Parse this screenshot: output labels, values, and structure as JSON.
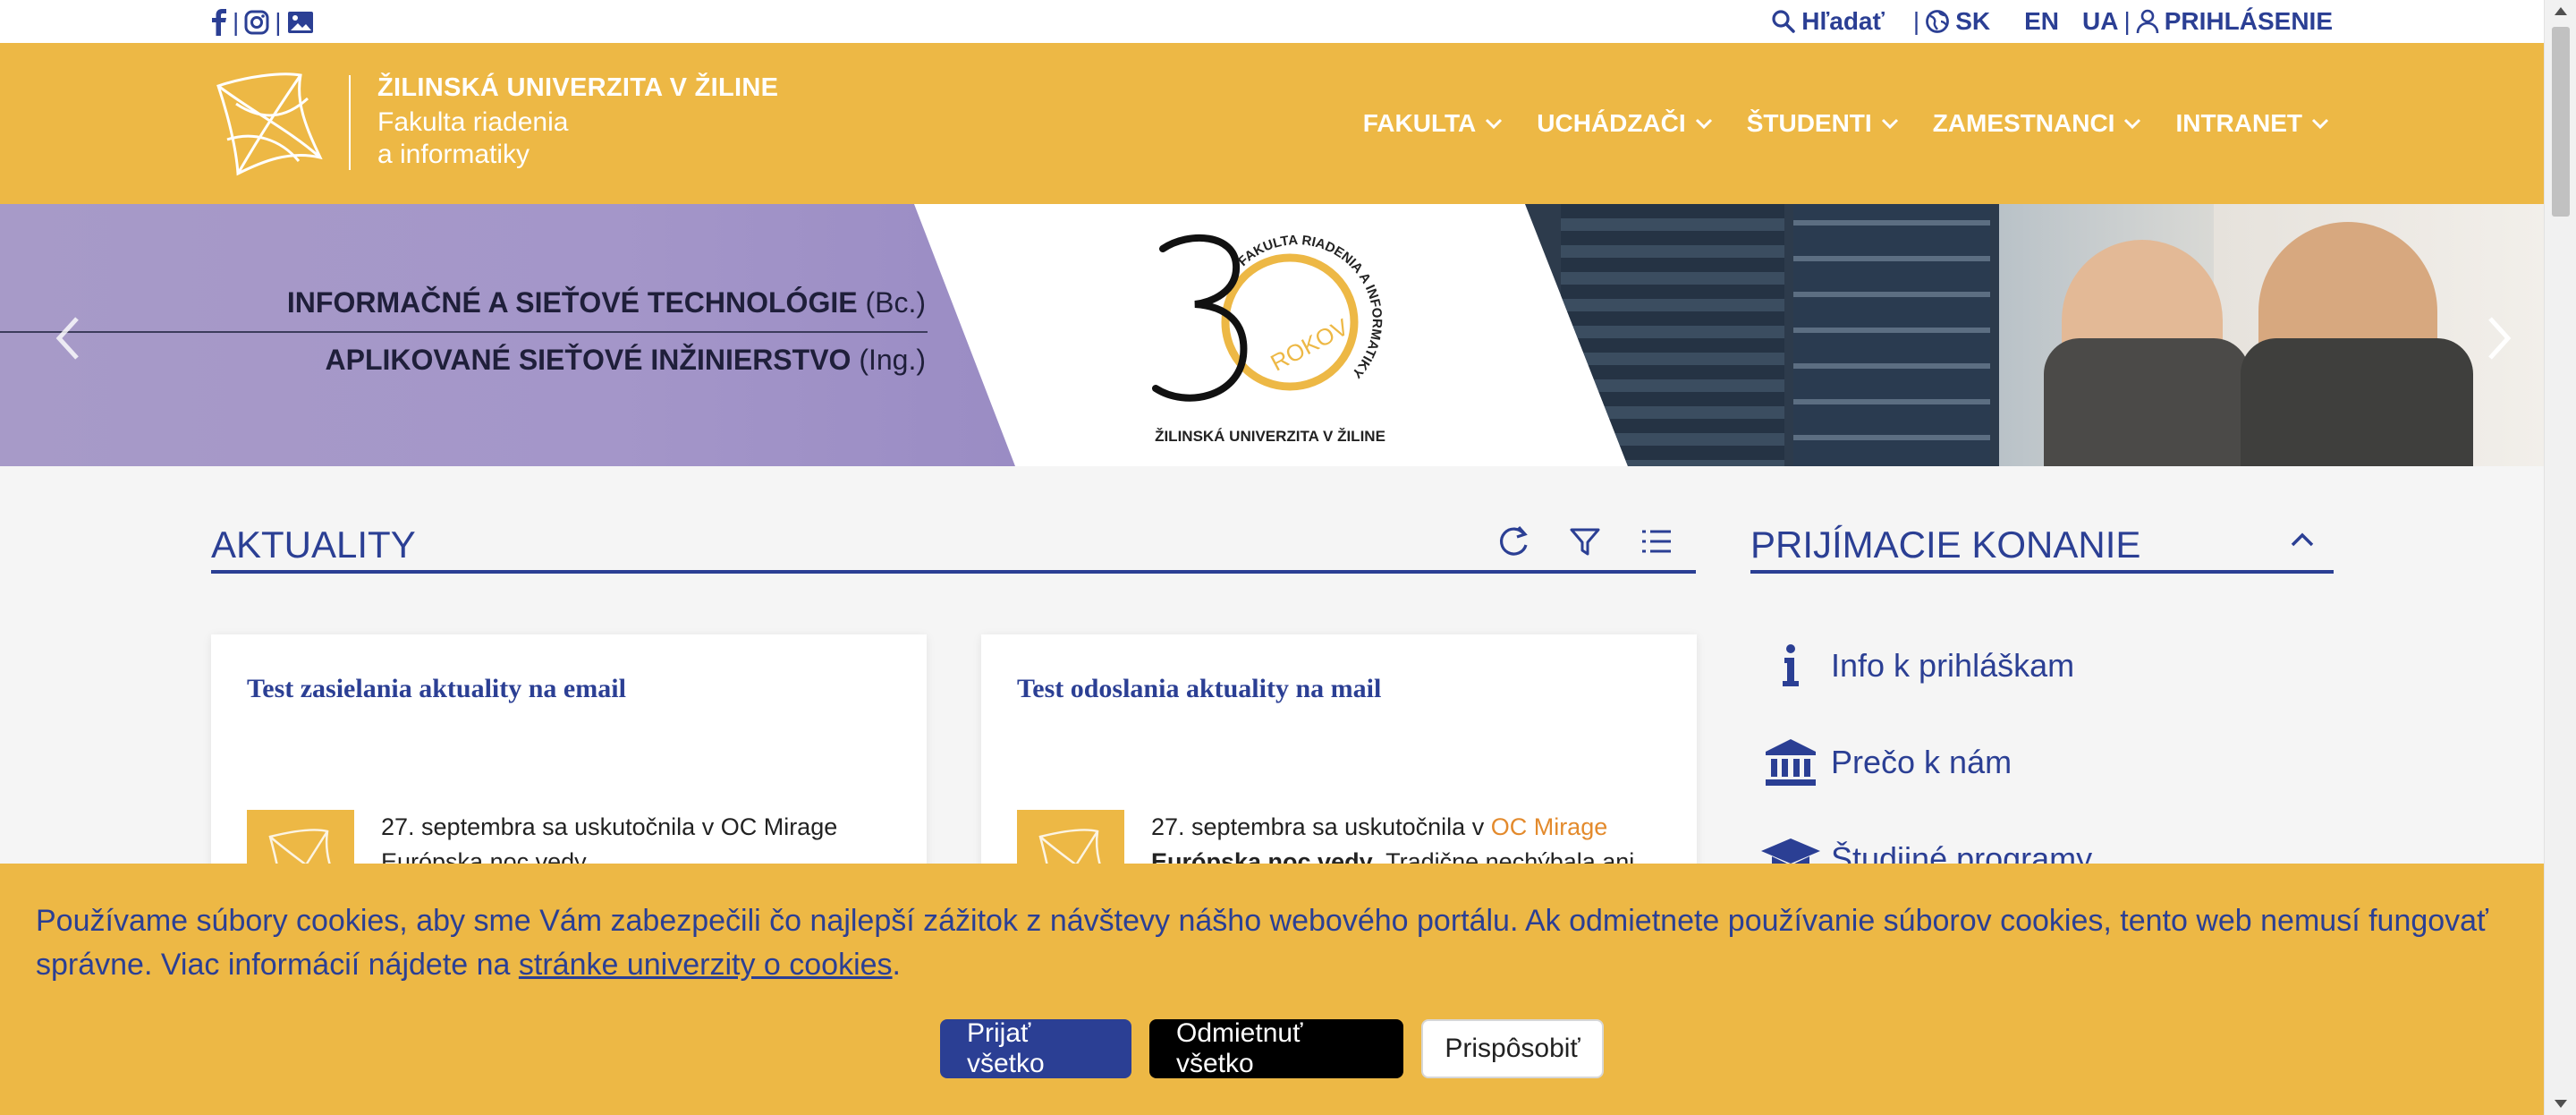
{
  "colors": {
    "accent_yellow": "#edb845",
    "brand_blue": "#2b3f94",
    "link_orange": "#e38a2c"
  },
  "topbar": {
    "social_icons": [
      "facebook-icon",
      "instagram-icon",
      "gallery-icon"
    ],
    "separator": "|",
    "search_label": "Hľadať",
    "lang_sk": "SK",
    "lang_en": "EN",
    "lang_ua": "UA",
    "login_label": "PRIHLÁSENIE"
  },
  "header": {
    "university": "ŽILINSKÁ UNIVERZITA V ŽILINE",
    "faculty_line1": "Fakulta riadenia",
    "faculty_line2": "a informatiky",
    "nav": [
      {
        "label": "FAKULTA"
      },
      {
        "label": "UCHÁDZAČI"
      },
      {
        "label": "ŠTUDENTI"
      },
      {
        "label": "ZAMESTNANCI"
      },
      {
        "label": "INTRANET"
      }
    ]
  },
  "hero": {
    "program1": "INFORMAČNÉ A SIEŤOVÉ TECHNOLÓGIE",
    "program1_degree": "(Bc.)",
    "program2": "APLIKOVANÉ SIEŤOVÉ INŽINIERSTVO",
    "program2_degree": "(Ing.)",
    "badge_number": "30",
    "badge_ring_text": "FAKULTA RIADENIA A INFORMATIKY",
    "badge_years": "ROKOV",
    "badge_caption": "ŽILINSKÁ UNIVERZITA V ŽILINE"
  },
  "news": {
    "title": "AKTUALITY",
    "tools": [
      "refresh-icon",
      "filter-icon",
      "list-icon"
    ],
    "cards": [
      {
        "title": "Test zasielania aktuality na email",
        "excerpt_lead": "27. septembra sa uskutočnila v OC Mirage",
        "excerpt_rest": "Európska noc vedy."
      },
      {
        "title": "Test odoslania aktuality na mail",
        "excerpt_lead": "27. septembra sa uskutočnila v ",
        "excerpt_link": "OC Mirage",
        "excerpt_bold": "Európska noc vedy",
        "excerpt_rest": ". Tradične nechýbala ani"
      }
    ]
  },
  "admissions": {
    "title": "PRIJÍMACIE KONANIE",
    "items": [
      {
        "icon": "info-icon",
        "label": "Info k prihláškam"
      },
      {
        "icon": "institution-icon",
        "label": "Prečo k nám"
      },
      {
        "icon": "graduation-cap-icon",
        "label": "Študijné programy"
      }
    ]
  },
  "cookie": {
    "text_before": "Používame súbory cookies, aby sme Vám zabezpečili čo najlepší zážitok z návštevy nášho webového portálu. Ak odmietnete používanie súborov cookies, tento web nemusí fungovať správne. Viac informácií nájdete na ",
    "link": "stránke univerzity o cookies",
    "text_after": ".",
    "accept": "Prijať všetko",
    "reject": "Odmietnuť všetko",
    "customize": "Prispôsobiť"
  }
}
